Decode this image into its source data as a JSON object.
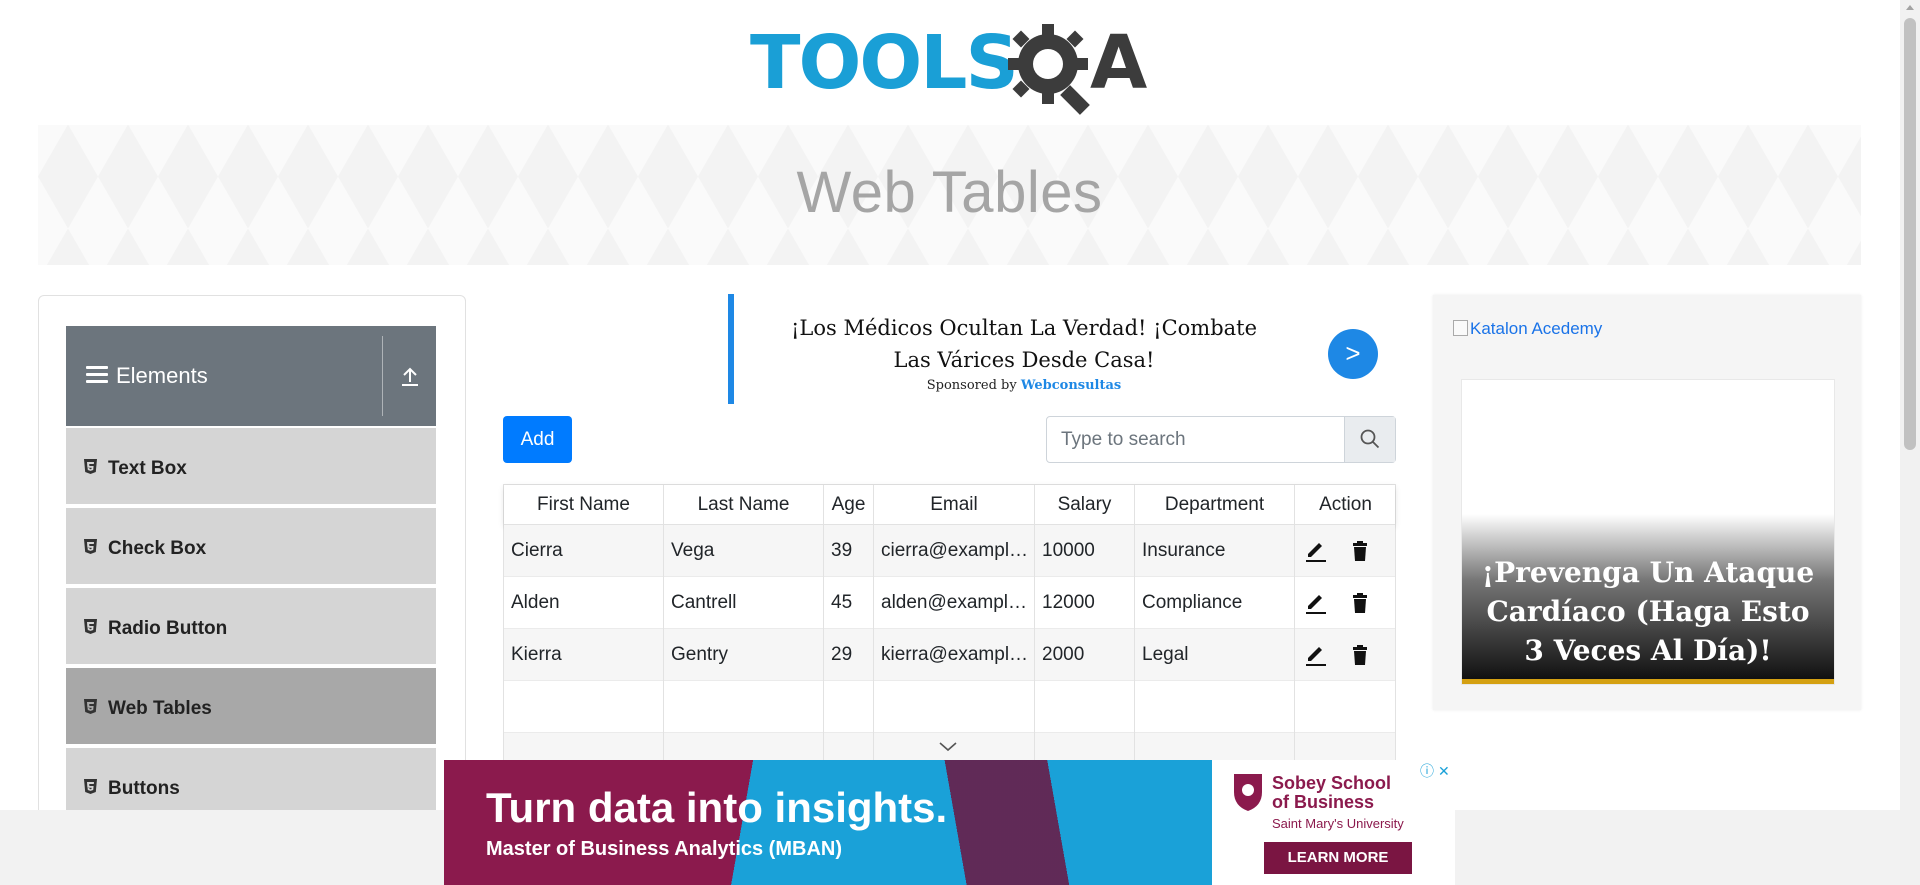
{
  "logo": {
    "part1": "TOOLS",
    "part2": "A",
    "alt": "TOOLSQA"
  },
  "banner": {
    "title": "Web Tables"
  },
  "sidebar": {
    "group": "Elements",
    "items": [
      {
        "label": "Text Box",
        "active": false
      },
      {
        "label": "Check Box",
        "active": false
      },
      {
        "label": "Radio Button",
        "active": false
      },
      {
        "label": "Web Tables",
        "active": true
      },
      {
        "label": "Buttons",
        "active": false
      }
    ]
  },
  "ad_top": {
    "headline": "¡Los Médicos Ocultan La Verdad! ¡Combate Las Várices Desde Casa!",
    "sponsor_prefix": "Sponsored by",
    "sponsor_name": "Webconsultas",
    "arrow": ">"
  },
  "controls": {
    "add_label": "Add",
    "search_placeholder": "Type to search"
  },
  "table": {
    "headers": [
      "First Name",
      "Last Name",
      "Age",
      "Email",
      "Salary",
      "Department",
      "Action"
    ],
    "rows": [
      [
        "Cierra",
        "Vega",
        "39",
        "cierra@example.com",
        "10000",
        "Insurance"
      ],
      [
        "Alden",
        "Cantrell",
        "45",
        "alden@example.com",
        "12000",
        "Compliance"
      ],
      [
        "Kierra",
        "Gentry",
        "29",
        "kierra@example.com",
        "2000",
        "Legal"
      ]
    ]
  },
  "ad_right": {
    "broken_image_alt": "Katalon Acedemy",
    "message": "¡Prevenga Un Ataque Cardíaco (Haga Esto 3 Veces Al Día)!"
  },
  "ad_bottom": {
    "headline": "Turn data into insights.",
    "sub": "Master of Business Analytics (MBAN)",
    "brand_line1": "Sobey School",
    "brand_line2": "of Business",
    "brand_sub": "Saint Mary's University",
    "cta": "LEARN MORE"
  }
}
